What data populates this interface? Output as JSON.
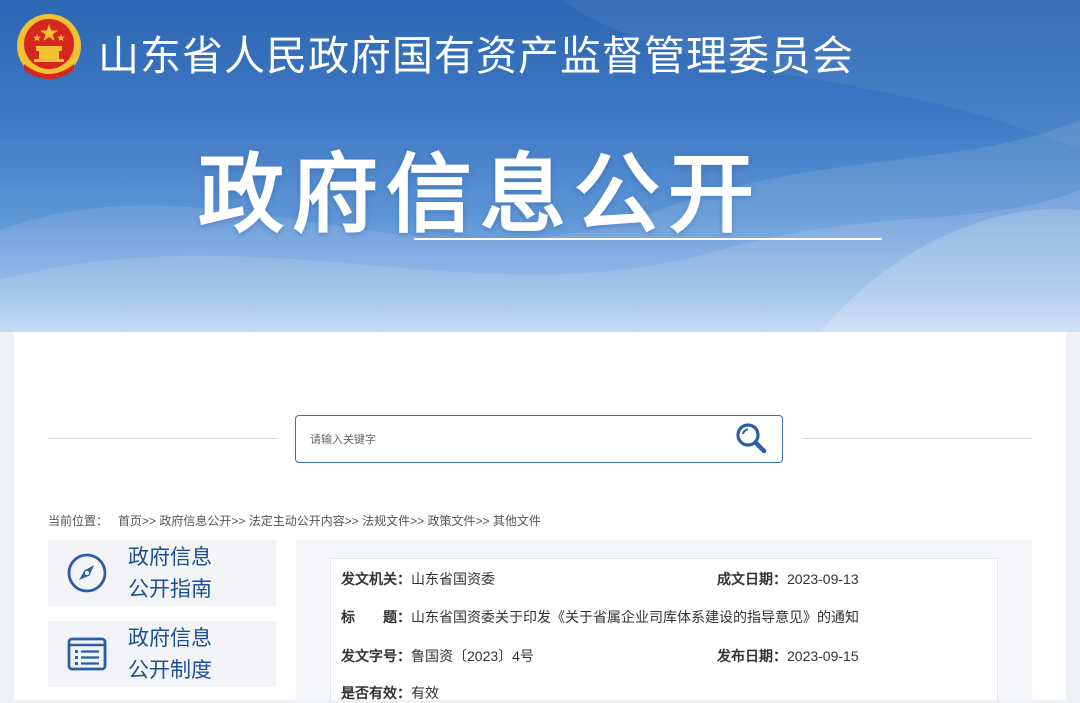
{
  "header": {
    "site_title": "山东省人民政府国有资产监督管理委员会",
    "section_title": "政府信息公开"
  },
  "search": {
    "placeholder": "请输入关键字"
  },
  "breadcrumb": {
    "prefix": "当前位置：",
    "items": [
      "首页",
      "政府信息公开",
      "法定主动公开内容",
      "法规文件",
      "政策文件",
      "其他文件"
    ],
    "separator": ">>"
  },
  "sidebar": {
    "items": [
      {
        "line1": "政府信息",
        "line2": "公开指南",
        "icon": "compass-icon"
      },
      {
        "line1": "政府信息",
        "line2": "公开制度",
        "icon": "document-list-icon"
      }
    ]
  },
  "document": {
    "issuer_label": "发文机关：",
    "issuer": "山东省国资委",
    "created_label": "成文日期：",
    "created": "2023-09-13",
    "title_label": "标　　题：",
    "title": "山东省国资委关于印发《关于省属企业司库体系建设的指导意见》的通知",
    "doc_no_label": "发文字号：",
    "doc_no": "鲁国资〔2023〕4号",
    "published_label": "发布日期：",
    "published": "2023-09-15",
    "valid_label": "是否有效：",
    "valid": "有效"
  },
  "colors": {
    "brand_blue": "#2e67b3",
    "link_blue": "#1e4f92",
    "emblem_red": "#d7261e",
    "emblem_gold": "#f2c230"
  }
}
